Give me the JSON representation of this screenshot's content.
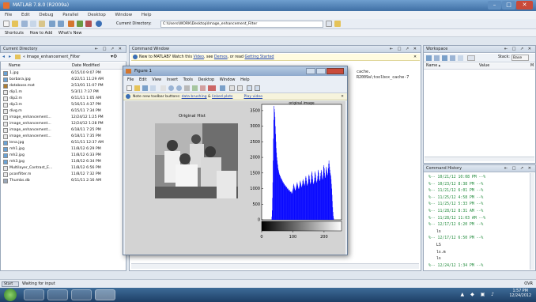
{
  "window": {
    "title": "MATLAB 7.8.0 (R2009a)",
    "controls": [
      "–",
      "□",
      "✕"
    ]
  },
  "menu": [
    "File",
    "Edit",
    "Debug",
    "Parallel",
    "Desktop",
    "Window",
    "Help"
  ],
  "toolbar": {
    "current_dir_label": "Current Directory:",
    "current_dir_value": "C:\\Users\\WORK\\Desktop\\Image_enhancement_Filter"
  },
  "shortcuts": [
    "Shortcuts",
    "How to Add",
    "What's New"
  ],
  "current_directory": {
    "title": "Current Directory",
    "path": "« Image_enhancement_Filter",
    "columns": [
      "Name",
      "Date Modified"
    ],
    "files": [
      {
        "name": "1.jpg",
        "date": "6/15/10 9:07 PM",
        "icon": "image"
      },
      {
        "name": "barbara.jpg",
        "date": "4/22/11 11:29 AM",
        "icon": "image"
      },
      {
        "name": "database.mat",
        "date": "2/13/01 11:07 PM",
        "icon": "mat"
      },
      {
        "name": "dip1.m",
        "date": "5/3/11 7:37 PM",
        "icon": "mfile"
      },
      {
        "name": "dip2.m",
        "date": "6/11/11 1:05 AM",
        "icon": "mfile"
      },
      {
        "name": "dip3.m",
        "date": "5/16/11 4:37 PM",
        "icon": "mfile"
      },
      {
        "name": "divg.m",
        "date": "6/15/11 7:34 PM",
        "icon": "mfile"
      },
      {
        "name": "image_enhancement...",
        "date": "12/24/12 1:25 PM",
        "icon": "mfile"
      },
      {
        "name": "image_enhancement...",
        "date": "12/24/12 1:28 PM",
        "icon": "mfile"
      },
      {
        "name": "image_enhancement...",
        "date": "6/18/11 7:25 PM",
        "icon": "mfile"
      },
      {
        "name": "image_enhancement...",
        "date": "6/18/11 7:35 PM",
        "icon": "mfile"
      },
      {
        "name": "lena.jpg",
        "date": "6/11/11 12:37 AM",
        "icon": "image"
      },
      {
        "name": "mh1.jpg",
        "date": "11/8/12 6:29 PM",
        "icon": "image"
      },
      {
        "name": "mh2.jpg",
        "date": "11/8/12 6:33 PM",
        "icon": "image"
      },
      {
        "name": "mh3.jpg",
        "date": "11/8/12 6:34 PM",
        "icon": "image"
      },
      {
        "name": "Multilayer_Contrast_E...",
        "date": "11/8/12 6:56 PM",
        "icon": "mfile"
      },
      {
        "name": "pconfilter.m",
        "date": "11/8/12 7:32 PM",
        "icon": "mfile"
      },
      {
        "name": "Thumbs.db",
        "date": "6/11/11 2:16 AM",
        "icon": "db"
      }
    ]
  },
  "command_window": {
    "title": "Command Window",
    "banner_prefix": "New to MATLAB? Watch this ",
    "banner_video": "Video",
    "banner_mid": ", see ",
    "banner_demos": "Demos",
    "banner_or": ", or read ",
    "banner_getting": "Getting Started",
    "line1": "cache.",
    "line2": "R2009a\\toolbox_cache-7"
  },
  "figure": {
    "title": "Figure 1",
    "menu": [
      "File",
      "Edit",
      "View",
      "Insert",
      "Tools",
      "Desktop",
      "Window",
      "Help"
    ],
    "note_prefix": "Note new toolbar buttons: ",
    "note_link1": "data brushing",
    "note_and": " & ",
    "note_link2": "linked plots",
    "note_video": "Play video",
    "image_title": "Original Hist",
    "hist_title": "original image"
  },
  "chart_data": {
    "type": "bar",
    "title": "original image",
    "ylim": [
      0,
      3700
    ],
    "xlim": [
      0,
      256
    ],
    "yticks": [
      0,
      500,
      1000,
      1500,
      2000,
      2500,
      3000,
      3500
    ],
    "xticks": [
      0,
      100,
      200
    ],
    "grid": false,
    "color": "#0000ff",
    "values": [
      0,
      0,
      0,
      0,
      0,
      0,
      0,
      0,
      0,
      0,
      0,
      0,
      0,
      0,
      0,
      0,
      0,
      0,
      0,
      0,
      0,
      0,
      0,
      0,
      0,
      0,
      0,
      0,
      0,
      0,
      0,
      0,
      100,
      300,
      700,
      1200,
      1900,
      2600,
      3200,
      3650,
      3550,
      3450,
      3300,
      3000,
      2750,
      2500,
      2300,
      2150,
      2000,
      1900,
      1800,
      1750,
      1650,
      1600,
      1550,
      1500,
      1450,
      1450,
      1400,
      1400,
      1350,
      1350,
      1300,
      1300,
      1300,
      1250,
      1250,
      1200,
      1200,
      1200,
      1150,
      1150,
      1150,
      1100,
      1100,
      1100,
      1100,
      1050,
      1050,
      1050,
      1050,
      1000,
      1000,
      1000,
      1000,
      950,
      950,
      950,
      950,
      950,
      900,
      900,
      900,
      900,
      900,
      850,
      850,
      850,
      900,
      950,
      1000,
      1100,
      1150,
      1100,
      1050,
      1000,
      950,
      950,
      950,
      1000,
      1050,
      1100,
      1150,
      1200,
      1150,
      1100,
      1050,
      1000,
      1000,
      1000,
      1050,
      1100,
      1200,
      1250,
      1200,
      1150,
      1100,
      1050,
      1050,
      1100,
      1150,
      1250,
      1300,
      1250,
      1200,
      1150,
      1100,
      1100,
      1150,
      1250,
      1350,
      1400,
      1350,
      1250,
      1150,
      1100,
      1100,
      1150,
      1200,
      1300,
      1400,
      1450,
      1400,
      1300,
      1200,
      1150,
      1150,
      1200,
      1300,
      1450,
      1550,
      1500,
      1400,
      1300,
      1200,
      1150,
      1150,
      1200,
      1250,
      1350,
      1500,
      1550,
      1450,
      1350,
      1250,
      1200,
      1200,
      1250,
      1300,
      1400,
      1550,
      1600,
      1500,
      1400,
      1300,
      1250,
      1250,
      1300,
      1400,
      1500,
      1600,
      1550,
      1450,
      1350,
      1300,
      1300,
      1400,
      1550,
      1700,
      1750,
      1650,
      1500,
      1400,
      1350,
      1350,
      1450,
      1600,
      1700,
      1650,
      1550,
      1450,
      1400,
      1500,
      1650,
      1800,
      1900,
      1800,
      1700,
      1600,
      1500,
      1450,
      1400,
      1300,
      1150,
      1000,
      800,
      600,
      400,
      250,
      120,
      50,
      0,
      0,
      0,
      0,
      0,
      0,
      0,
      0,
      0,
      0,
      0,
      0,
      0,
      0,
      0,
      0,
      0,
      0,
      0,
      0,
      0,
      0,
      0,
      0,
      0
    ]
  },
  "workspace": {
    "title": "Workspace",
    "stack_label": "Stack:",
    "stack_value": "Base",
    "columns": [
      "Name ▴",
      "Value",
      "M"
    ]
  },
  "command_history": {
    "title": "Command History",
    "lines": [
      "%-- 10/21/12 10:08 PM --%",
      "%-- 10/23/12 8:38 PM --%",
      "%-- 11/21/12 6:01 PM --%",
      "%-- 11/25/12 4:58 PM --%",
      "%-- 11/25/12 5:33 PM --%",
      "%-- 11/28/12 8:31 AM --%",
      "%-- 11/28/12 11:03 AM --%",
      "%-- 12/17/12 6:20 PM --%",
      "ls",
      "%-- 12/17/12 6:50 PM --%",
      "LS",
      "ls.m",
      "ls",
      "%-- 12/24/12 1:34 PM --%"
    ]
  },
  "status": {
    "start": "Start",
    "text": "Waiting for input",
    "ovr": "OVR"
  },
  "taskbar": {
    "time": "1:57 PM",
    "date": "12/24/2012"
  }
}
